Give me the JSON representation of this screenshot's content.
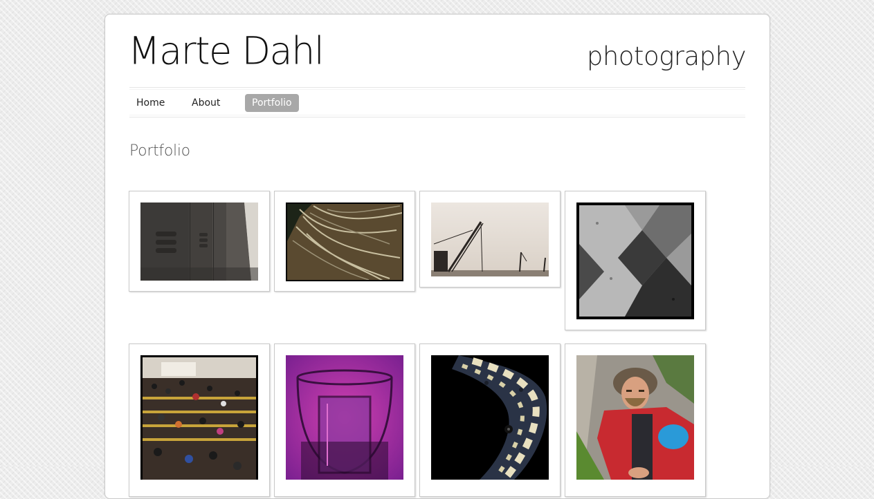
{
  "header": {
    "title": "Marte Dahl",
    "tagline": "photography"
  },
  "nav": {
    "items": [
      {
        "label": "Home",
        "active": false
      },
      {
        "label": "About",
        "active": false
      },
      {
        "label": "Portfolio",
        "active": true
      }
    ]
  },
  "main": {
    "heading": "Portfolio",
    "thumbnails": [
      {
        "subject": "lockers-corridor"
      },
      {
        "subject": "tree-roots-wall"
      },
      {
        "subject": "construction-cranes"
      },
      {
        "subject": "zigzag-stairs-shadow"
      },
      {
        "subject": "crowd-crosswalk"
      },
      {
        "subject": "glass-on-purple"
      },
      {
        "subject": "snake-closeup"
      },
      {
        "subject": "man-with-fur-hat"
      }
    ]
  },
  "colors": {
    "nav_active_bg": "#a8a8a8",
    "page_bg": "#ffffff"
  }
}
